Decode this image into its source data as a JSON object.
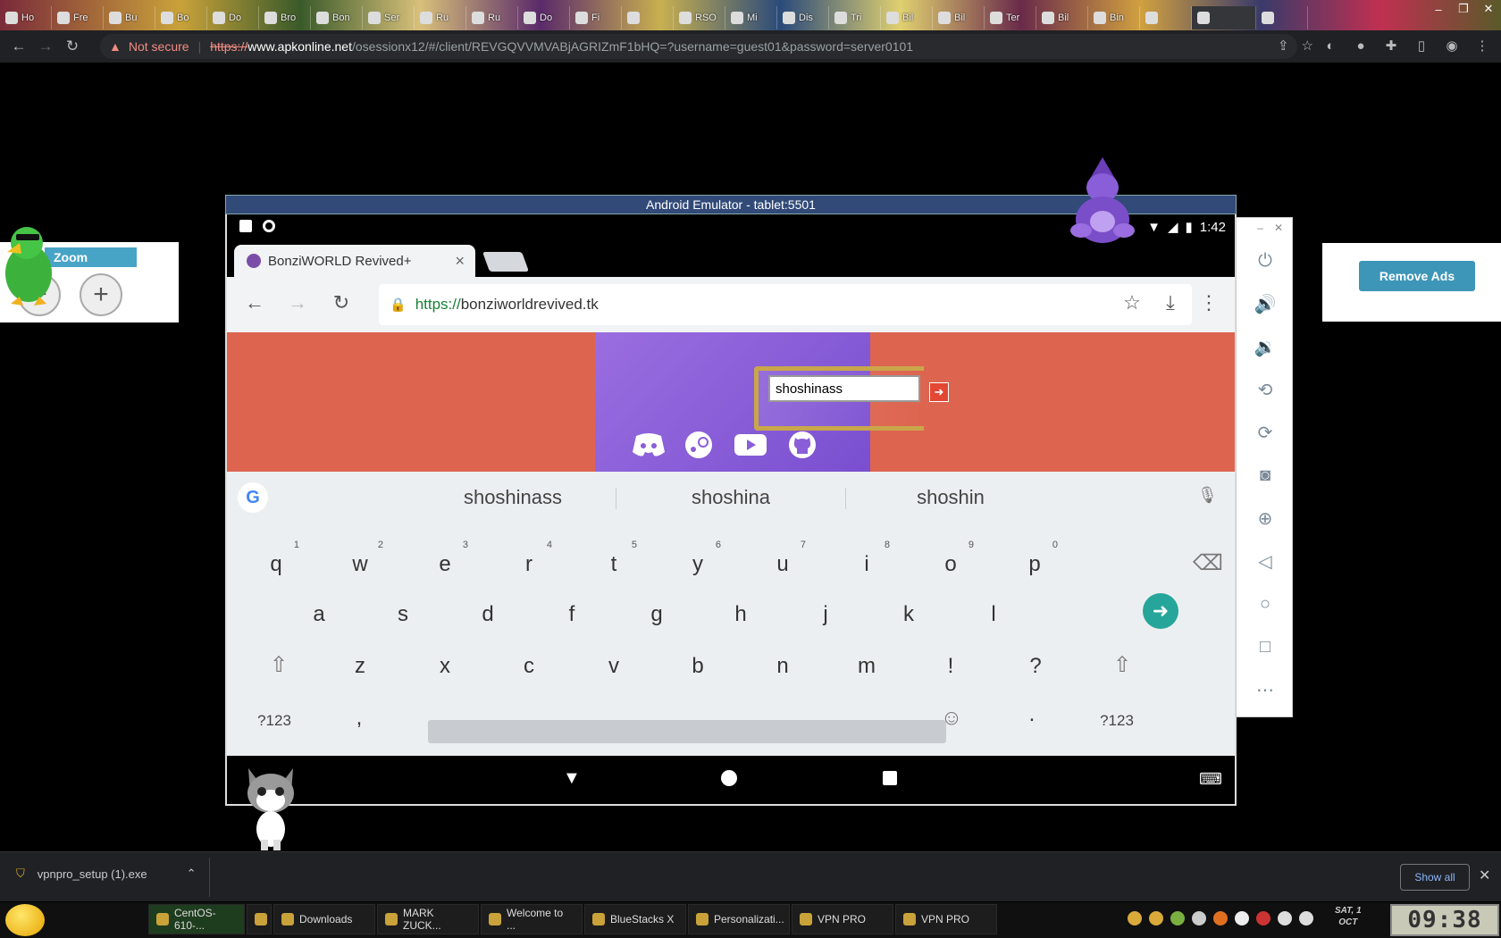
{
  "browser": {
    "not_secure": "Not secure",
    "url_scheme": "https://",
    "url_host": "www.apkonline.net",
    "url_path": "/osessionx12/#/client/REVGQVVMVABjAGRIZmF1bHQ=?username=guest01&password=server0101",
    "tab_labels": [
      "Ho",
      "Fre",
      "Bu",
      "Bo",
      "Do",
      "Bro",
      "Bon",
      "Ser",
      "Ru",
      "Ru",
      "Do",
      "Fi",
      "",
      "RSO",
      "Mi",
      "Dis",
      "Tri",
      "Bil",
      "Bil",
      "Ter",
      "Bil",
      "Bin",
      "",
      "",
      ""
    ],
    "win_min": "–",
    "win_max": "❐",
    "win_close": "✕"
  },
  "zoom": {
    "label": "Zoom",
    "minus": "−",
    "plus": "+"
  },
  "ads": {
    "remove_label": "Remove Ads"
  },
  "emulator": {
    "title": "Android Emulator - tablet:5501",
    "time": "1:42",
    "tab_title": "BonziWORLD Revived+",
    "url_https": "https://",
    "url_domain": "bonziworldrevived.tk",
    "name_value": "shoshinass",
    "suggestions": [
      "shoshinass",
      "shoshina",
      "shoshin"
    ],
    "keys_row1": [
      {
        "k": "q",
        "n": "1"
      },
      {
        "k": "w",
        "n": "2"
      },
      {
        "k": "e",
        "n": "3"
      },
      {
        "k": "r",
        "n": "4"
      },
      {
        "k": "t",
        "n": "5"
      },
      {
        "k": "y",
        "n": "6"
      },
      {
        "k": "u",
        "n": "7"
      },
      {
        "k": "i",
        "n": "8"
      },
      {
        "k": "o",
        "n": "9"
      },
      {
        "k": "p",
        "n": "0"
      }
    ],
    "keys_row2": [
      "a",
      "s",
      "d",
      "f",
      "g",
      "h",
      "j",
      "k",
      "l"
    ],
    "keys_row3": [
      "z",
      "x",
      "c",
      "v",
      "b",
      "n",
      "m",
      "!",
      "?"
    ],
    "sym_label": "?123",
    "comma": ",",
    "period": "."
  },
  "side_controls": [
    "power",
    "volume-up",
    "volume-down",
    "rotate-left",
    "rotate-right",
    "screenshot",
    "zoom",
    "back",
    "home",
    "overview",
    "more"
  ],
  "downloads": {
    "file": "vpnpro_setup (1).exe",
    "show_all": "Show all"
  },
  "taskbar": {
    "tasks": [
      "CentOS-610-...",
      "",
      "Downloads",
      "MARK ZUCK...",
      "Welcome to ...",
      "BlueStacks X",
      "Personalizati...",
      "VPN PRO",
      "VPN PRO"
    ],
    "date_day": "SAT, 1",
    "date_month": "OCT",
    "clock": "09:38"
  },
  "colors": {
    "accent": "#48a4c6",
    "page_bg": "#dd6550",
    "hero": "#8a5ed8",
    "enter": "#26a69a"
  }
}
